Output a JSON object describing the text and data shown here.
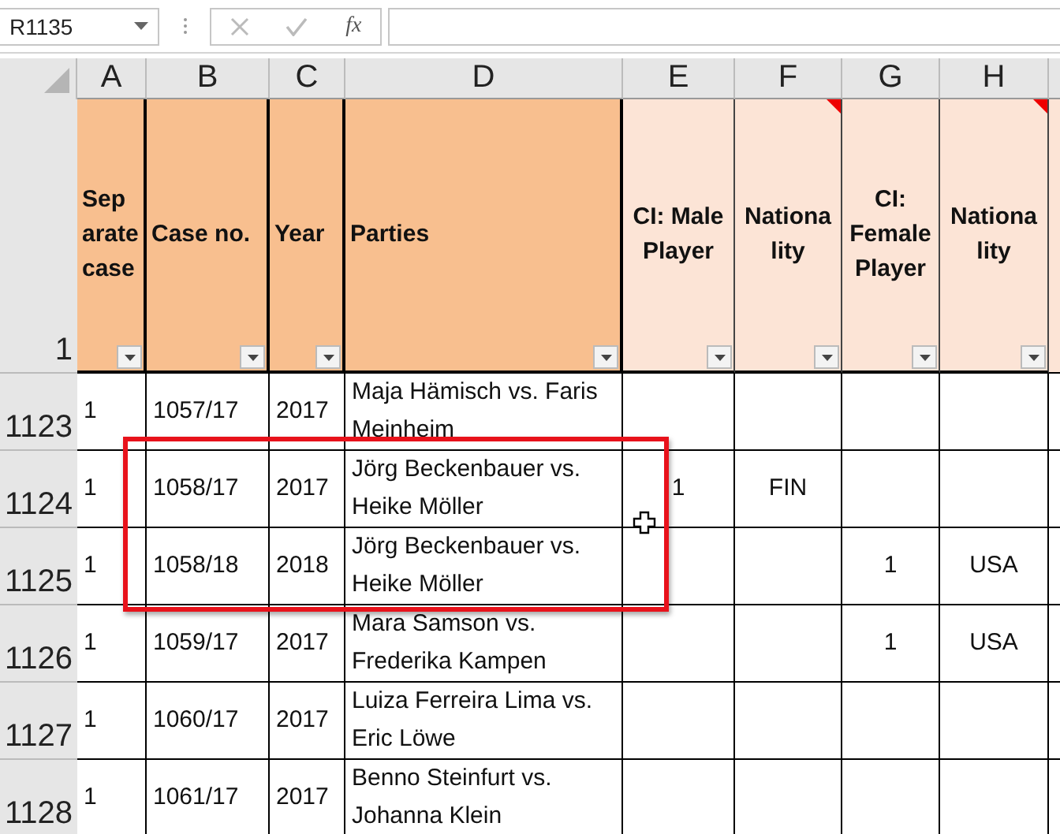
{
  "name_box": {
    "value": "R1135"
  },
  "formula_bar": {
    "function_label": "fx"
  },
  "columns": [
    {
      "letter": "A",
      "header": "Sep arate case",
      "kind": "main",
      "color": "#f8bf8f",
      "comment": false
    },
    {
      "letter": "B",
      "header": "Case no.",
      "kind": "main",
      "color": "#f8bf8f",
      "comment": false
    },
    {
      "letter": "C",
      "header": "Year",
      "kind": "main",
      "color": "#f8bf8f",
      "comment": false
    },
    {
      "letter": "D",
      "header": "Parties",
      "kind": "main",
      "color": "#f8bf8f",
      "comment": false
    },
    {
      "letter": "E",
      "header": "CI: Male Player",
      "kind": "detail",
      "color": "#fce4d6",
      "comment": false
    },
    {
      "letter": "F",
      "header": "Nationa lity",
      "kind": "detail",
      "color": "#fce4d6",
      "comment": true
    },
    {
      "letter": "G",
      "header": "CI: Female Player",
      "kind": "detail",
      "color": "#fce4d6",
      "comment": false
    },
    {
      "letter": "H",
      "header": "Nationa lity",
      "kind": "detail",
      "color": "#fce4d6",
      "comment": true
    }
  ],
  "header_row_number": "1",
  "rows": [
    {
      "number": "1123",
      "cells": [
        "1",
        "1057/17",
        "2017",
        "Maja Hämisch vs. Faris Meinheim",
        "",
        "",
        "",
        ""
      ]
    },
    {
      "number": "1124",
      "cells": [
        "1",
        "1058/17",
        "2017",
        "Jörg Beckenbauer vs. Heike Möller",
        "1",
        "FIN",
        "",
        ""
      ]
    },
    {
      "number": "1125",
      "cells": [
        "1",
        "1058/18",
        "2018",
        "Jörg Beckenbauer vs. Heike Möller",
        "",
        "",
        "1",
        "USA"
      ]
    },
    {
      "number": "1126",
      "cells": [
        "1",
        "1059/17",
        "2017",
        "Mara Samson vs. Frederika Kampen",
        "",
        "",
        "1",
        "USA"
      ]
    },
    {
      "number": "1127",
      "cells": [
        "1",
        "1060/17",
        "2017",
        "Luiza Ferreira Lima vs. Eric Löwe",
        "",
        "",
        "",
        ""
      ]
    },
    {
      "number": "1128",
      "cells": [
        "1",
        "1061/17",
        "2017",
        "Benno Steinfurt vs. Johanna Klein",
        "",
        "",
        "",
        ""
      ]
    }
  ]
}
